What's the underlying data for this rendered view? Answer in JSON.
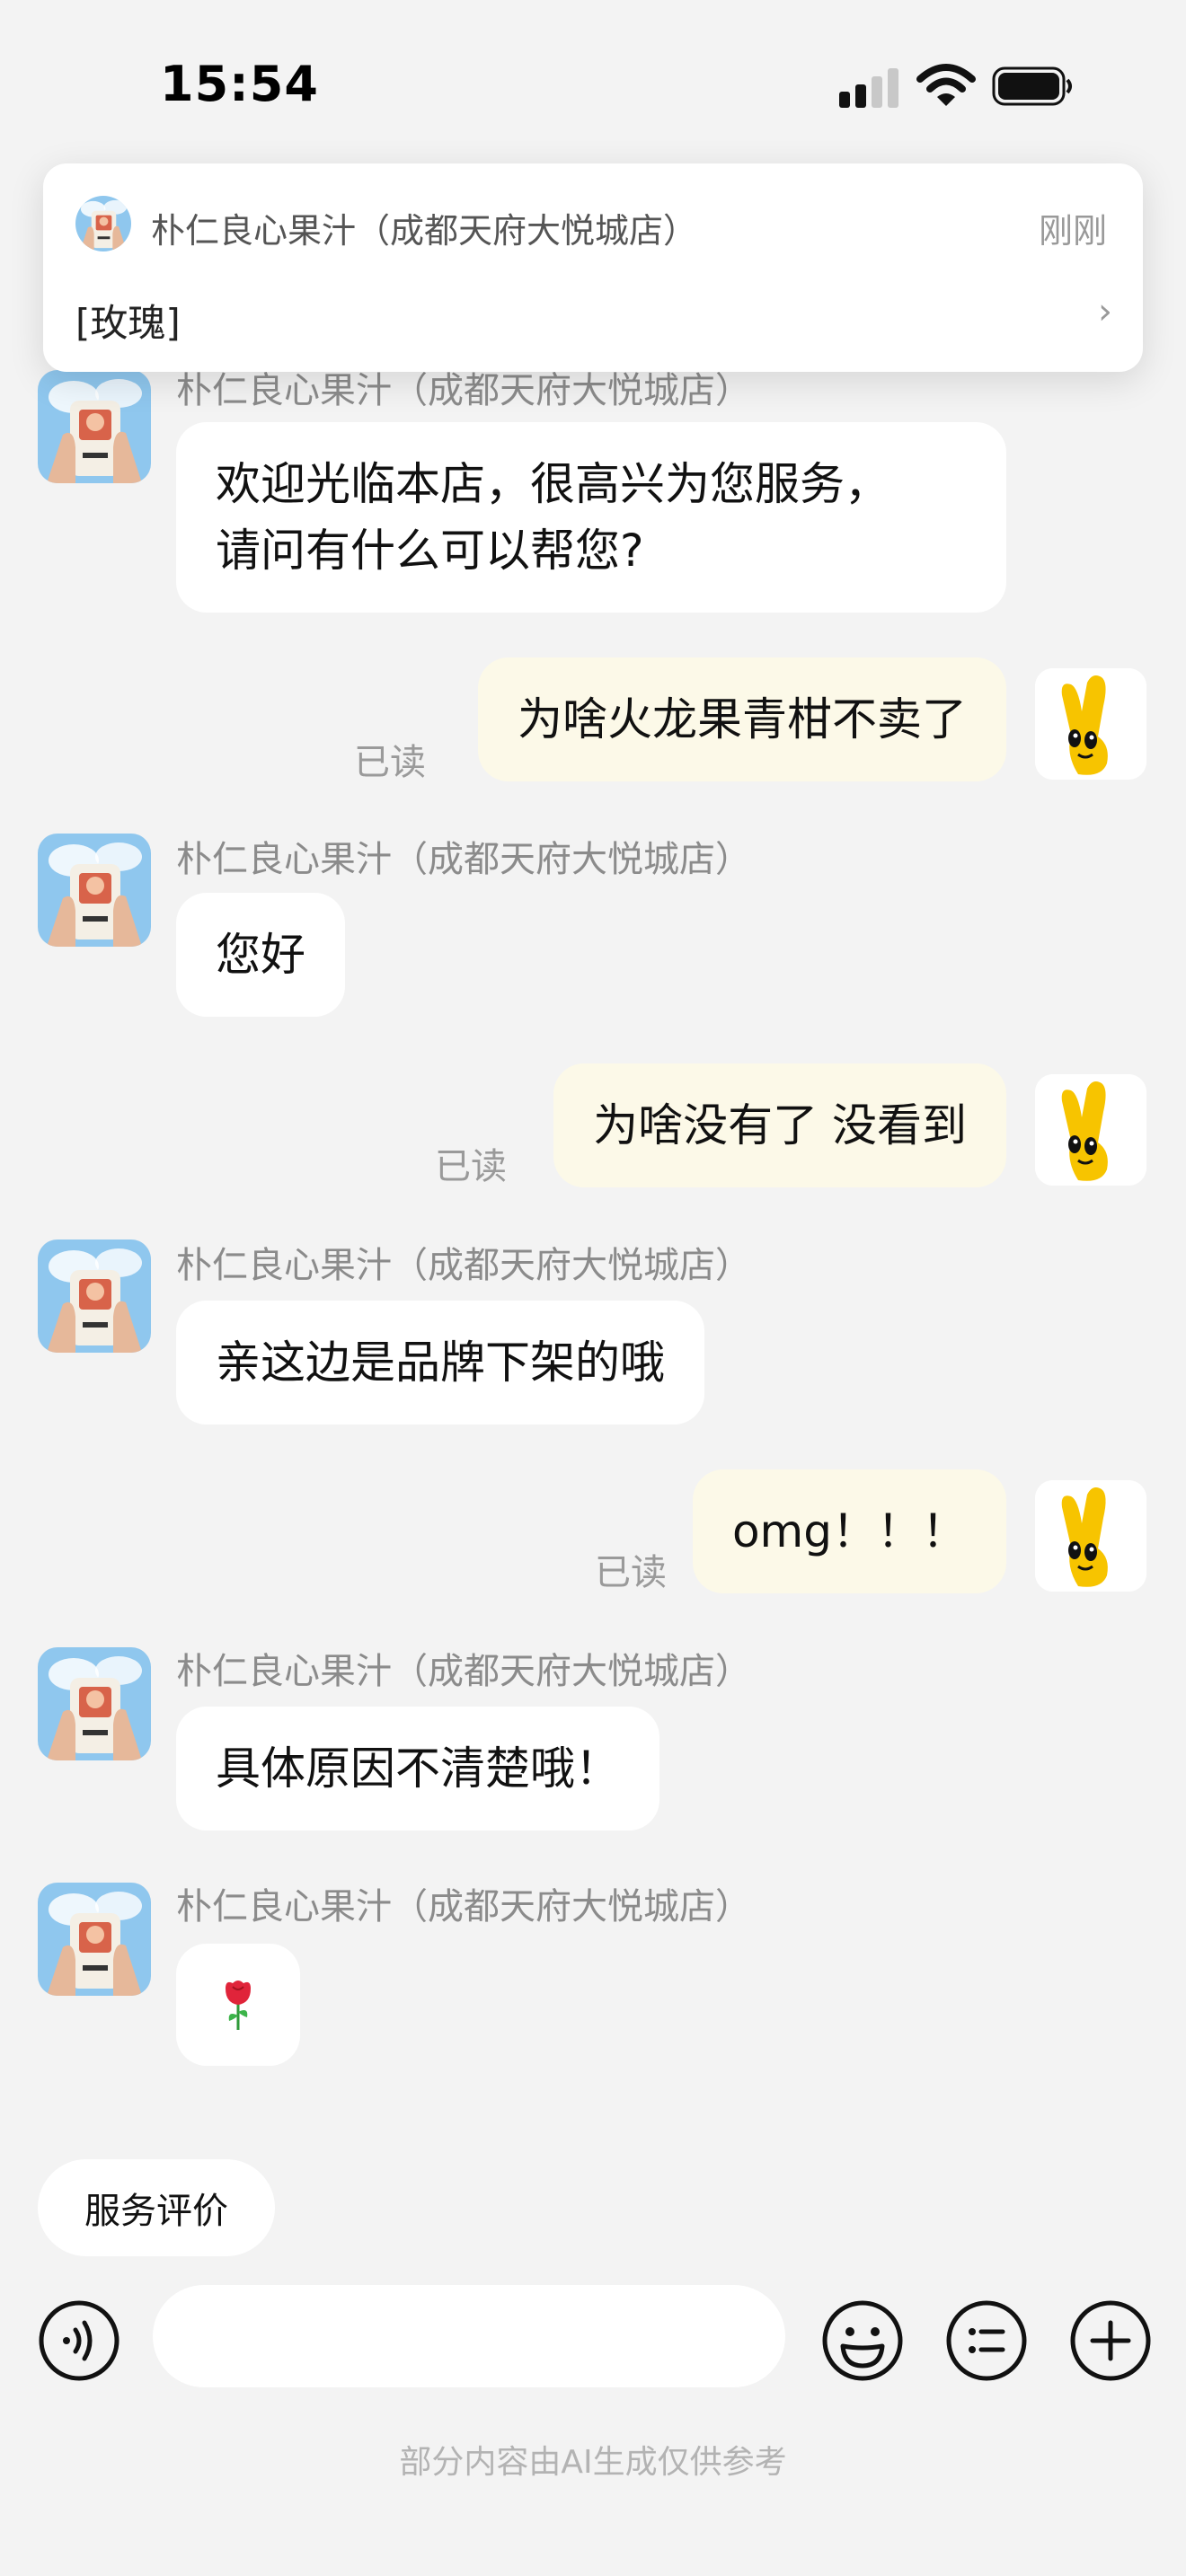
{
  "status_bar": {
    "time": "15:54"
  },
  "notification": {
    "sender": "朴仁良心果汁（成都天府大悦城店）",
    "time": "刚刚",
    "message": "[玫瑰]"
  },
  "shop_name": "朴仁良心果汁（成都天府大悦城店）",
  "messages": [
    {
      "from": "shop",
      "text_lines": [
        "欢迎光临本店，很高兴为您服务，",
        "请问有什么可以帮您?"
      ]
    },
    {
      "from": "user",
      "text": "为啥火龙果青柑不卖了",
      "receipt": "已读"
    },
    {
      "from": "shop",
      "text": "您好"
    },
    {
      "from": "user",
      "text": "为啥没有了 没看到",
      "receipt": "已读"
    },
    {
      "from": "shop",
      "text": "亲这边是品牌下架的哦"
    },
    {
      "from": "user",
      "text": "omg！！！",
      "receipt": "已读"
    },
    {
      "from": "shop",
      "text": "具体原因不清楚哦！"
    },
    {
      "from": "shop",
      "text": "🌹"
    }
  ],
  "actions": {
    "rating_label": "服务评价"
  },
  "input": {
    "placeholder": ""
  },
  "footer": {
    "ai_note": "部分内容由AI生成仅供参考"
  },
  "colors": {
    "page_bg": "#f3f3f3",
    "incoming_bubble": "#ffffff",
    "outgoing_bubble": "#fcf9e8",
    "muted_text": "#8b8b8b"
  },
  "icons": {
    "voice": "voice-icon",
    "emoji": "emoji-icon",
    "menu": "list-menu-icon",
    "plus": "plus-icon",
    "user_avatar": "yellow-peace-hand-avatar",
    "shop_avatar": "juice-cup-avatar"
  }
}
